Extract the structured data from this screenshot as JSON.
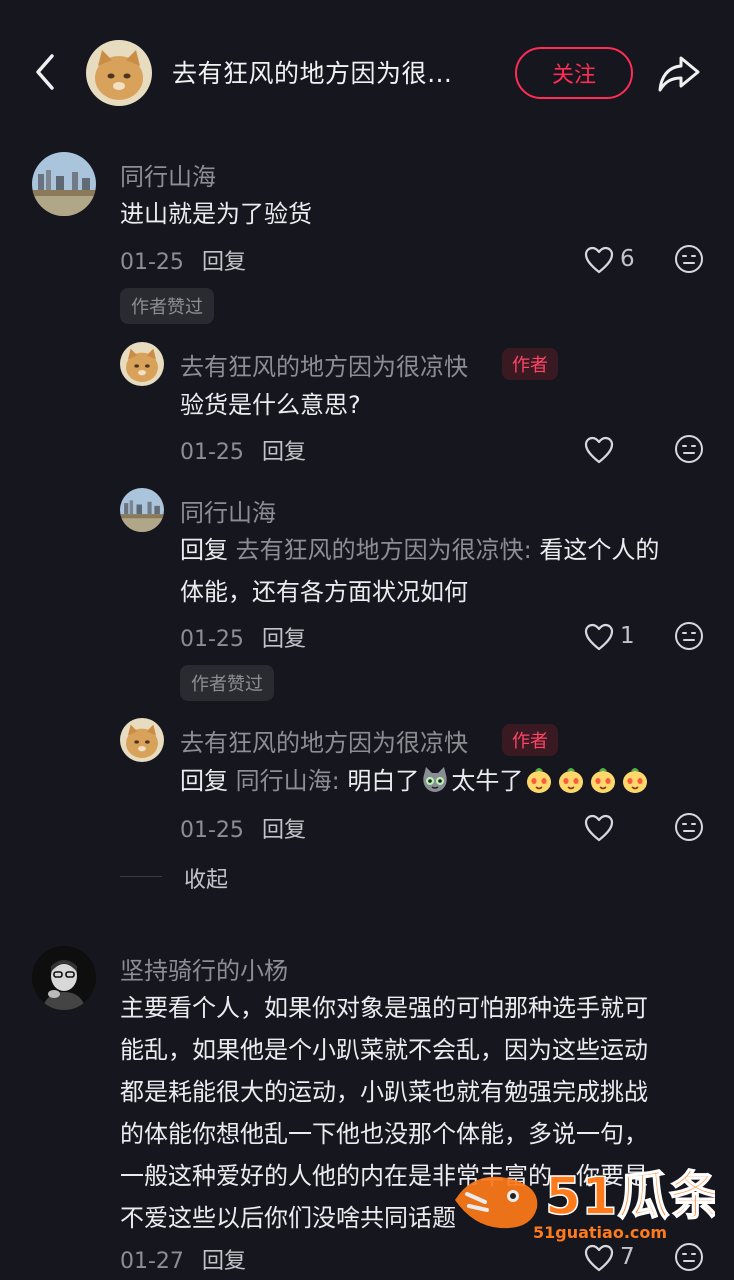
{
  "header": {
    "title": "去有狂风的地方因为很…",
    "follow_label": "关注"
  },
  "comments": [
    {
      "username": "同行山海",
      "text": "进山就是为了验货",
      "date": "01-25",
      "reply_label": "回复",
      "likes": "6",
      "liked_badge": "作者赞过",
      "replies": [
        {
          "username": "去有狂风的地方因为很凉快",
          "author_badge": "作者",
          "text": "验货是什么意思?",
          "date": "01-25",
          "reply_label": "回复"
        },
        {
          "username": "同行山海",
          "reply_prefix": "回复",
          "reply_to": "去有狂风的地方因为很凉快:",
          "text_line1": " 看这个人的",
          "text_line2": "体能，还有各方面状况如何",
          "date": "01-25",
          "reply_label": "回复",
          "likes": "1",
          "liked_badge": "作者赞过"
        },
        {
          "username": "去有狂风的地方因为很凉快",
          "author_badge": "作者",
          "reply_prefix": "回复",
          "reply_to": "同行山海:",
          "text_a": " 明白了",
          "text_b": "太牛了",
          "date": "01-25",
          "reply_label": "回复"
        }
      ],
      "collapse_label": "收起"
    },
    {
      "username": "坚持骑行的小杨",
      "lines": [
        "主要看个人，如果你对象是强的可怕那种选手就可",
        "能乱，如果他是个小趴菜就不会乱，因为这些运动",
        "都是耗能很大的运动，小趴菜也就有勉强完成挑战",
        "的体能你想他乱一下他也没那个体能，多说一句，",
        "一般这种爱好的人他的内在是非常丰富的，你要是",
        "不爱这些以后你们没啥共同话题"
      ],
      "date": "01-27",
      "reply_label": "回复",
      "likes": "7"
    }
  ],
  "watermark": {
    "brand": "51瓜条",
    "url": "51guatiao.com"
  },
  "colors": {
    "background": "#16161e",
    "accent": "#ff2c55",
    "secondary_text": "#8d8d93"
  }
}
